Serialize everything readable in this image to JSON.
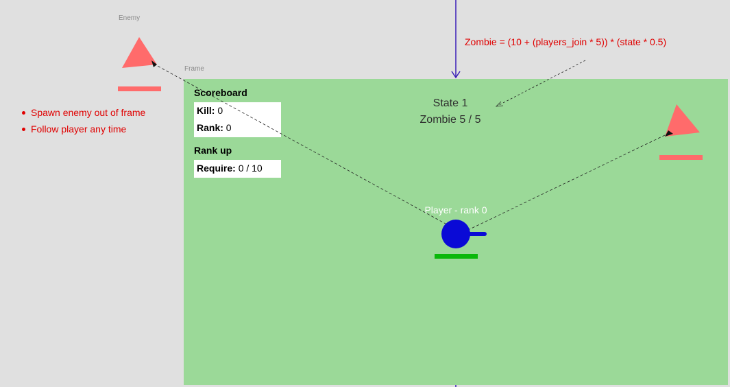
{
  "canvas": {
    "enemy_frame_label": "Enemy",
    "game_frame_label": "Frame"
  },
  "notes": {
    "items": [
      "Spawn enemy out of frame",
      "Follow player any time"
    ]
  },
  "formula": {
    "text": "Zombie = (10 + (players_join * 5)) * (state * 0.5)"
  },
  "scoreboard": {
    "title": "Scoreboard",
    "kill_label": "Kill:",
    "kill_value": "0",
    "rank_label": "Rank:",
    "rank_value": "0"
  },
  "rank_up": {
    "title": "Rank up",
    "require_label": "Require:",
    "require_value": "0 / 10"
  },
  "state": {
    "state_text": "State 1",
    "zombie_text": "Zombie 5 / 5"
  },
  "player": {
    "label": "Player - rank 0"
  },
  "colors": {
    "frame_bg": "#9bd998",
    "enemy": "#ff6b6b",
    "player": "#0a0ad6",
    "player_health": "#0ab80a",
    "annotation": "#e00000",
    "arrow": "#3a1fb8"
  },
  "icons": [
    "enemy-triangle-icon",
    "player-tank-icon"
  ]
}
